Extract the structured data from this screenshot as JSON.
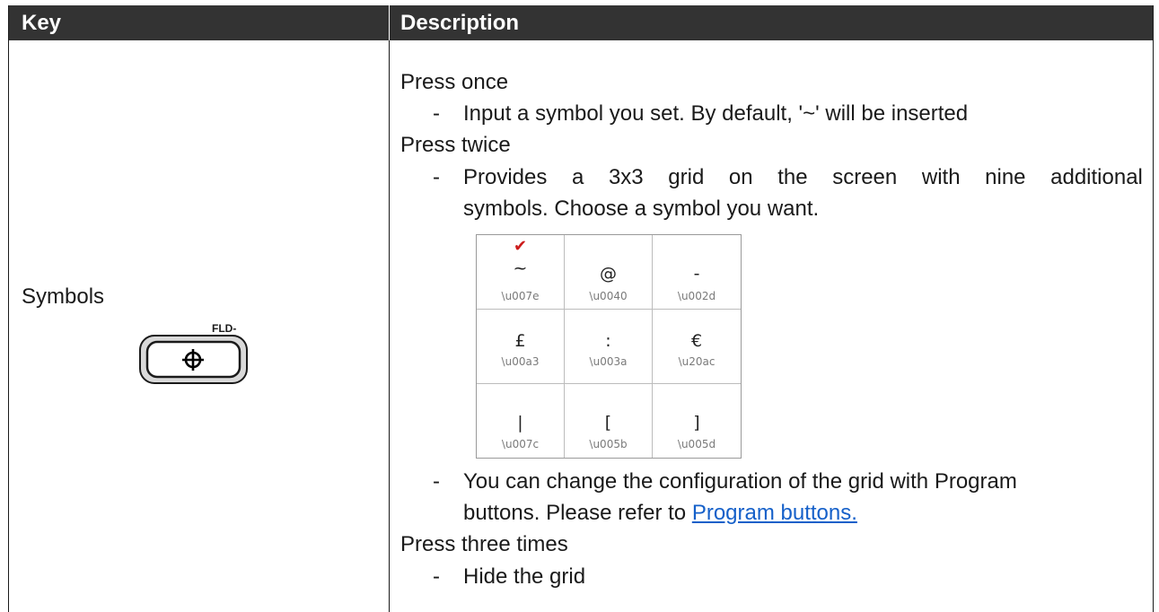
{
  "table": {
    "headers": {
      "key": "Key",
      "description": "Description"
    },
    "row": {
      "key_label": "Symbols",
      "key_icon": {
        "name": "crosshair-key-icon",
        "badge": "FLD-"
      },
      "description": {
        "press_once": "Press once",
        "press_once_note": "Input a symbol you set. By default, '~' will be inserted",
        "press_twice": "Press twice",
        "press_twice_note_line1": [
          "Provides",
          "a",
          "3x3",
          "grid",
          "on",
          "the",
          "screen",
          "with",
          "nine",
          "additional"
        ],
        "press_twice_note_line2": "symbols. Choose a symbol you want.",
        "grid": [
          {
            "symbol": "~",
            "code": "\\u007e",
            "selected": true
          },
          {
            "symbol": "@",
            "code": "\\u0040",
            "selected": false
          },
          {
            "symbol": "-",
            "code": "\\u002d",
            "selected": false
          },
          {
            "symbol": "£",
            "code": "\\u00a3",
            "selected": false
          },
          {
            "symbol": ":",
            "code": "\\u003a",
            "selected": false
          },
          {
            "symbol": "€",
            "code": "\\u20ac",
            "selected": false
          },
          {
            "symbol": "|",
            "code": "\\u007c",
            "selected": false
          },
          {
            "symbol": "[",
            "code": "\\u005b",
            "selected": false
          },
          {
            "symbol": "]",
            "code": "\\u005d",
            "selected": false
          }
        ],
        "grid_note_line1": "You can change the configuration of the grid with Program",
        "grid_note_line2_prefix": "buttons. Please refer to",
        "grid_note_link": "Program buttons.",
        "press_three": "Press three times",
        "press_three_note": "Hide the grid",
        "dash": "-",
        "check_mark": "✔",
        "link_color": "#1560c9",
        "check_color": "#cc1b1b",
        "header_color": "#333333"
      }
    }
  }
}
